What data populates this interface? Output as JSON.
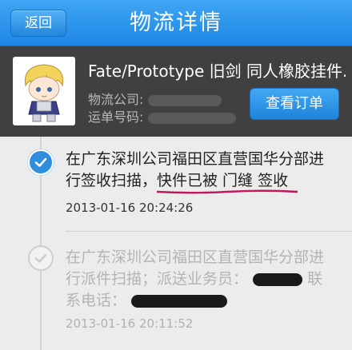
{
  "navbar": {
    "back_label": "返回",
    "title": "物流详情"
  },
  "order": {
    "product_name": "Fate/Prototype 旧剑 同人橡胶挂件...",
    "carrier_label": "物流公司:",
    "tracking_label": "运单号码:",
    "view_order_label": "查看订单"
  },
  "events": [
    {
      "line1": "在广东深圳公司福田区直营国华分部进",
      "line2_a": "行签收扫描，",
      "line2_b": "快件已被 门缝 签收",
      "time": "2013-01-16 20:24:26",
      "status": "done"
    },
    {
      "line1": "在广东深圳公司福田区直营国华分部进",
      "line2": "行派件扫描；派送业务员：",
      "line2_tail": "联",
      "line3": "系电话：",
      "time": "2013-01-16 20:11:52",
      "status": "past"
    }
  ],
  "colors": {
    "nav_blue": "#2a93ea",
    "header_dark": "#404040",
    "accent_underline": "#c1185b"
  }
}
